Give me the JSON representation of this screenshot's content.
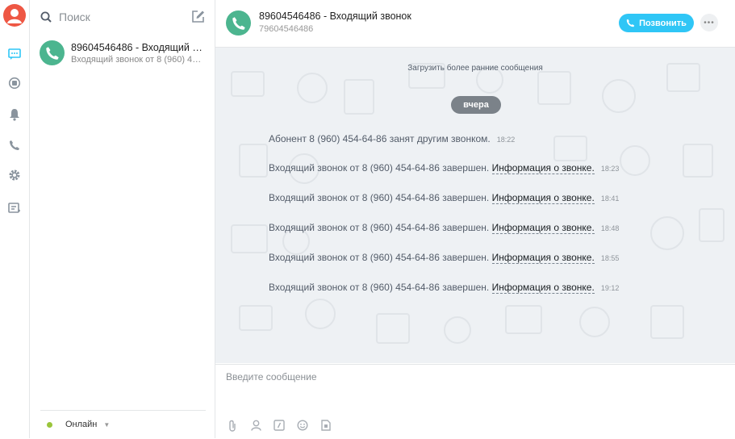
{
  "search": {
    "placeholder_label": "Поиск"
  },
  "chat_list": [
    {
      "title": "89604546486 - Входящий звонок",
      "preview": "Входящий звонок от 8 (960) 454-64-86 завершен."
    }
  ],
  "status": {
    "label": "Онлайн"
  },
  "header": {
    "name": "89604546486 - Входящий звонок",
    "number": "79604546486",
    "call_label": "Позвонить"
  },
  "messages": {
    "load_more": "Загрузить более ранние сообщения",
    "date": "вчера",
    "items": [
      {
        "text": "Абонент 8 (960) 454-64-86 занят другим звонком.",
        "link": "",
        "time": "18:22"
      },
      {
        "text": "Входящий звонок от 8 (960) 454-64-86 завершен. ",
        "link": "Информация о звонке.",
        "time": "18:23"
      },
      {
        "text": "Входящий звонок от 8 (960) 454-64-86 завершен. ",
        "link": "Информация о звонке.",
        "time": "18:41"
      },
      {
        "text": "Входящий звонок от 8 (960) 454-64-86 завершен. ",
        "link": "Информация о звонке.",
        "time": "18:48"
      },
      {
        "text": "Входящий звонок от 8 (960) 454-64-86 завершен. ",
        "link": "Информация о звонке.",
        "time": "18:55"
      },
      {
        "text": "Входящий звонок от 8 (960) 454-64-86 завершен. ",
        "link": "Информация о звонке.",
        "time": "19:12"
      }
    ]
  },
  "composer": {
    "placeholder": "Введите сообщение"
  },
  "colors": {
    "accent": "#2fc6f6",
    "avatar_user": "#ee5744",
    "avatar_chat": "#4cb58f",
    "online": "#9ac53b",
    "date_pill": "#7b8289"
  }
}
